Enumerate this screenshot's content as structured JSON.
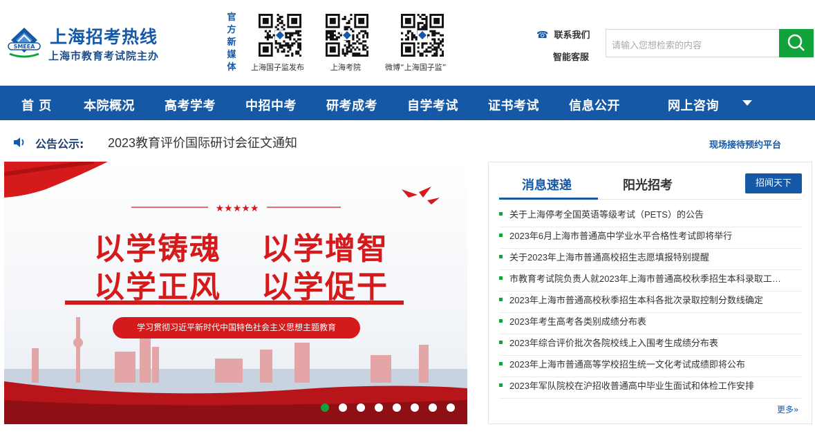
{
  "header": {
    "site_name": "上海招考热线",
    "site_subtitle": "上海市教育考试院主办",
    "logo_text": "SMEEA",
    "media_label": "官方新媒体",
    "qr_codes": [
      {
        "caption": "上海国子监发布"
      },
      {
        "caption": "上海考院"
      },
      {
        "caption": "微博“上海国子监”"
      }
    ],
    "contact_label": "联系我们",
    "service_label": "智能客服",
    "search_placeholder": "请输入您想检索的内容"
  },
  "nav": {
    "items": [
      "首 页",
      "本院概况",
      "高考学考",
      "中招中考",
      "研考成考",
      "自学考试",
      "证书考试",
      "信息公开",
      "网上咨询"
    ]
  },
  "notice": {
    "label": "公告公示:",
    "text": "2023教育评价国际研讨会征文通知",
    "reception_link": "现场接待预约平台"
  },
  "banner": {
    "slogans": [
      "以学铸魂",
      "以学增智",
      "以学正风",
      "以学促干"
    ],
    "subtitle": "学习贯彻习近平新时代中国特色社会主义思想主题教育",
    "slide_count": 8,
    "active_slide": 1
  },
  "news_panel": {
    "tabs": [
      "消息速递",
      "阳光招考"
    ],
    "active_tab": "消息速递",
    "button_label": "招闻天下",
    "items": [
      "关于上海停考全国英语等级考试（PETS）的公告",
      "2023年6月上海市普通高中学业水平合格性考试即将举行",
      "关于2023年上海市普通高校招生志愿填报特别提醒",
      "市教育考试院负责人就2023年上海市普通高校秋季招生本科录取工…",
      "2023年上海市普通高校秋季招生本科各批次录取控制分数线确定",
      "2023年考生高考各类别成绩分布表",
      "2023年综合评价批次各院校线上入围考生成绩分布表",
      "2023年上海市普通高等学校招生统一文化考试成绩即将公布",
      "2023年军队院校在沪招收普通高中毕业生面试和体检工作安排"
    ],
    "more_label": "更多»"
  },
  "colors": {
    "brand_blue": "#1558a6",
    "accent_green": "#12a23c",
    "banner_red": "#d41a1a"
  }
}
